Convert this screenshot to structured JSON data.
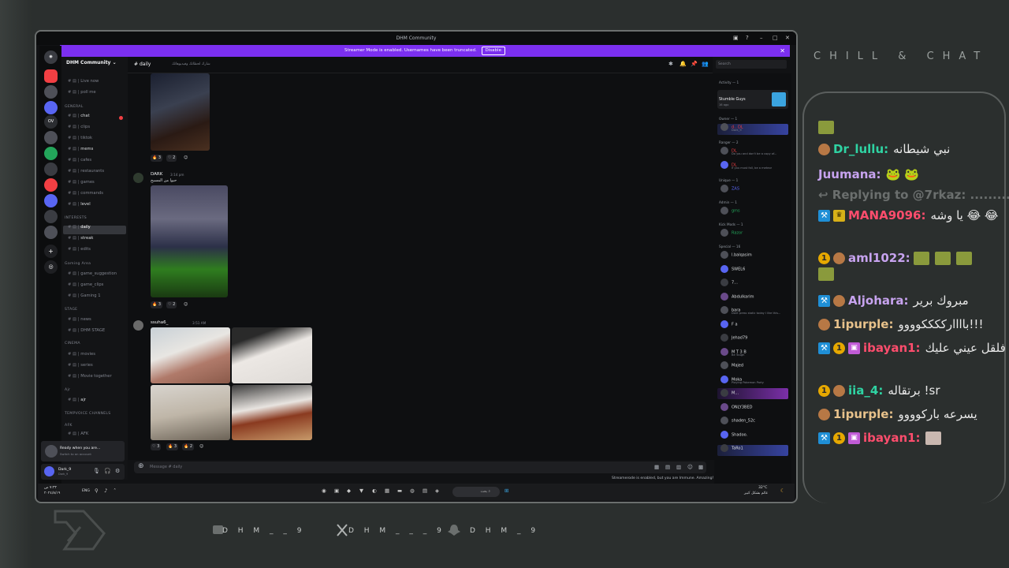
{
  "window": {
    "title": "DHM Community"
  },
  "banner": {
    "text": "Streamer Mode is enabled. Usernames have been truncated.",
    "button": "Disable"
  },
  "rail": [
    "OV"
  ],
  "sidebar": {
    "guild": "DHM Community",
    "items": [
      {
        "label": "Live now",
        "kind": "ch"
      },
      {
        "label": "poll me",
        "kind": "ch"
      },
      {
        "label": "GENERAL",
        "kind": "cat"
      },
      {
        "label": "chat",
        "kind": "ch",
        "bright": true
      },
      {
        "label": "clips",
        "kind": "ch"
      },
      {
        "label": "tiktok",
        "kind": "ch"
      },
      {
        "label": "mems",
        "kind": "ch",
        "bright": true
      },
      {
        "label": "cafes",
        "kind": "ch"
      },
      {
        "label": "restaurants",
        "kind": "ch"
      },
      {
        "label": "games",
        "kind": "ch"
      },
      {
        "label": "commands",
        "kind": "ch"
      },
      {
        "label": "level",
        "kind": "ch",
        "bright": true
      },
      {
        "label": "INTERESTS",
        "kind": "cat"
      },
      {
        "label": "daily",
        "kind": "ch",
        "active": true
      },
      {
        "label": "streak",
        "kind": "ch",
        "bright": true
      },
      {
        "label": "edits",
        "kind": "ch"
      },
      {
        "label": "Gaming Area",
        "kind": "cat"
      },
      {
        "label": "game_suggestion",
        "kind": "ch"
      },
      {
        "label": "game_clips",
        "kind": "ch"
      },
      {
        "label": "Gaming 1",
        "kind": "ch"
      },
      {
        "label": "STAGE",
        "kind": "cat"
      },
      {
        "label": "news",
        "kind": "ch"
      },
      {
        "label": "DHM STAGE",
        "kind": "ch"
      },
      {
        "label": "CINEMA",
        "kind": "cat"
      },
      {
        "label": "movies",
        "kind": "ch"
      },
      {
        "label": "series",
        "kind": "ch"
      },
      {
        "label": "Movie together",
        "kind": "ch"
      },
      {
        "label": "Ajr",
        "kind": "cat"
      },
      {
        "label": "ajr",
        "kind": "ch",
        "bright": true
      },
      {
        "label": "TEMPVOICE CHANNELS",
        "kind": "cat"
      },
      {
        "label": "AFK",
        "kind": "cat"
      },
      {
        "label": "AFK",
        "kind": "ch"
      }
    ],
    "ready": {
      "title": "Ready when you are...",
      "sub": "Switch to an account"
    },
    "user": {
      "name": "Dark_9",
      "status": "Dark_9"
    }
  },
  "header": {
    "channel": "daily",
    "topic": "شارك لحظاتك وفيديوهاتك",
    "search_placeholder": "Search"
  },
  "messages": [
    {
      "author": "DARK",
      "time": "3:14 pm",
      "text": "حيوا من المسيح",
      "reactions": [
        "3",
        "2"
      ]
    },
    {
      "author": "ssuha6_",
      "time": "3:51 AM",
      "reactions": [
        "3",
        "3",
        "2"
      ]
    }
  ],
  "first_reactions": [
    "3",
    "2"
  ],
  "composer": {
    "placeholder": "Message # daily"
  },
  "streamer_note": "Streamerode is enabled, but you are Immune. Amazing!",
  "members": {
    "activity_label": "Activity — 1",
    "activity_game": "Stumble Guys",
    "activity_sub": "16 ago",
    "groups": [
      {
        "label": "Owner — 1",
        "members": [
          {
            "name": "d.. DL",
            "sub": "Dark_9"
          }
        ]
      },
      {
        "label": "Ranger — 2",
        "members": [
          {
            "name": "DL",
            "sub": "Do you and don't be a copy of..."
          },
          {
            "name": "DL",
            "sub": "If you must fall, be a meteor"
          }
        ]
      },
      {
        "label": "Unique — 1",
        "members": [
          {
            "name": "ZAS",
            "sub": ""
          }
        ]
      },
      {
        "label": "Admin — 1",
        "members": [
          {
            "name": "gms",
            "sub": ""
          }
        ]
      },
      {
        "label": "Kick Mods — 1",
        "members": [
          {
            "name": "Razor",
            "sub": ""
          }
        ]
      },
      {
        "label": "Special — 16",
        "members": [
          {
            "name": "l.balqasim",
            "sub": ""
          },
          {
            "name": "SWEL6",
            "sub": ""
          },
          {
            "name": "7...",
            "sub": ""
          },
          {
            "name": "Abdulkarim",
            "sub": ""
          },
          {
            "name": "bara",
            "sub": "Dont press static today I like this..."
          },
          {
            "name": "F a",
            "sub": ""
          },
          {
            "name": "Jehad79",
            "sub": ""
          },
          {
            "name": "M T 3 B",
            "sub": "Be Tough"
          },
          {
            "name": "Majed",
            "sub": ""
          },
          {
            "name": "Moka",
            "sub": "Playing Pokemon Party"
          },
          {
            "name": "M...",
            "sub": ""
          },
          {
            "name": "ONLY3BED",
            "sub": ""
          },
          {
            "name": "shaden_52c",
            "sub": ""
          },
          {
            "name": "Shadoo.",
            "sub": ""
          },
          {
            "name": "TaRo1",
            "sub": ""
          }
        ]
      }
    ]
  },
  "taskbar": {
    "time": "٧:٣٢ ص",
    "date": "٢٠٢٤/٨/١٩",
    "lang": "ENG",
    "search": "بحث",
    "temp": "32°C",
    "weather": "غائم بشكل كبير"
  },
  "overlay": {
    "brand": "CHILL & CHAT",
    "chat": [
      {
        "user": "Dr_lullu:",
        "color": "#2fd3a3",
        "text": "نبي شيطانه",
        "badges": [
          "cap"
        ]
      },
      {
        "user": "Juumana:",
        "color": "#c7a3ef",
        "text": "🐸 🐸",
        "badges": []
      },
      {
        "user": "Replying to @7rkaz: ............",
        "color": "#6b6f6e",
        "text": "",
        "badges": [
          "reply"
        ]
      },
      {
        "user": "MANA9096:",
        "color": "#ff4d6d",
        "text": "يا وشه 😂 😂",
        "badges": [
          "mod",
          "crown"
        ]
      },
      {
        "user": "aml1022:",
        "color": "#c7a3ef",
        "text": "",
        "badges": [
          "one",
          "cap"
        ]
      },
      {
        "user": "Aljohara:",
        "color": "#c7a3ef",
        "text": "مبروك برير",
        "badges": [
          "mod",
          "cap"
        ]
      },
      {
        "user": "1ipurple:",
        "color": "#e8c28b",
        "text": "باااارككككوووو!!!",
        "badges": [
          "cap"
        ]
      },
      {
        "user": "ibayan1:",
        "color": "#ff4d6d",
        "text": "فلقل عيني عليك",
        "badges": [
          "mod",
          "one",
          "gift"
        ]
      },
      {
        "user": "iia_4:",
        "color": "#2fd3a3",
        "text": "برتقاله !sr",
        "badges": [
          "one",
          "cap"
        ]
      },
      {
        "user": "1ipurple:",
        "color": "#e8c28b",
        "text": "يسرعه باركوووو",
        "badges": [
          "cap"
        ]
      },
      {
        "user": "ibayan1:",
        "color": "#ff4d6d",
        "text": "",
        "badges": [
          "mod",
          "one",
          "gift"
        ]
      }
    ]
  },
  "footer": {
    "handles": [
      "D H M _ _ 9",
      "D H M _ _ _ 9",
      "D H M _ 9"
    ]
  }
}
